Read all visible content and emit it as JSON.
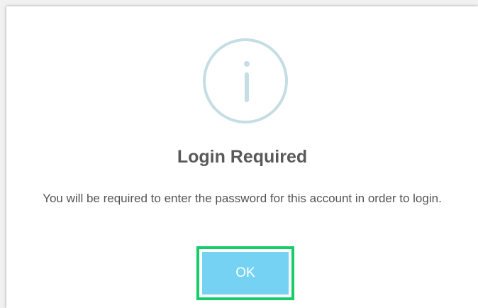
{
  "dialog": {
    "icon": "info-circle-icon",
    "title": "Login Required",
    "message": "You will be required to enter the password for this account in order to login.",
    "ok_label": "OK"
  },
  "colors": {
    "icon": "#c5dde4",
    "title_text": "#595959",
    "message_text": "#545454",
    "button_bg": "#75d2f2",
    "button_text": "#ffffff",
    "highlight_border": "#14cc6a"
  }
}
